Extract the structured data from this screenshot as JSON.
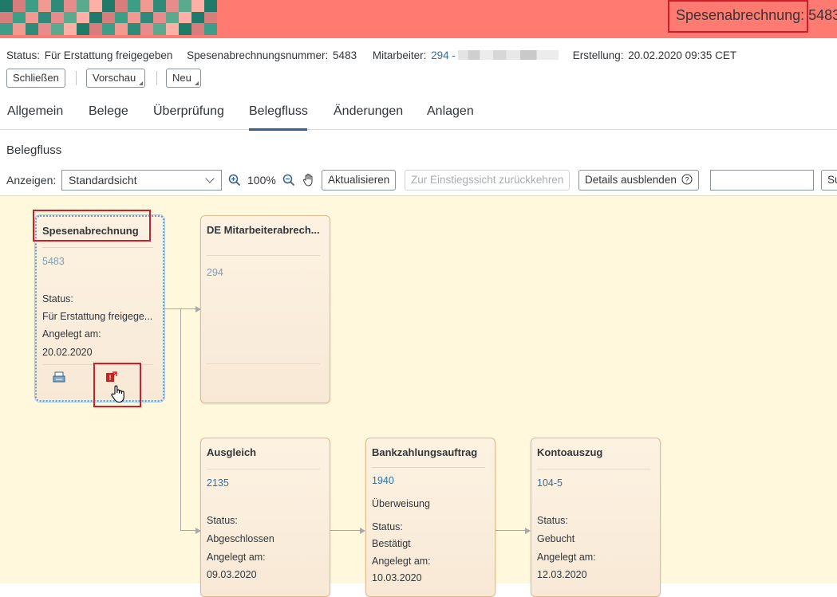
{
  "app": {
    "title": "Spesenabrechnung: 5483",
    "colors": {
      "topbar": "#ff7a70",
      "highlight": "#d11d2a",
      "link": "#2f6fa5",
      "canvas": "#fff8dc"
    }
  },
  "header": {
    "status_label": "Status:",
    "status_value": "Für Erstattung freigegeben",
    "number_label": "Spesenabrechnungsnummer:",
    "number_value": "5483",
    "employee_label": "Mitarbeiter:",
    "employee_value": "294 -",
    "created_label": "Erstellung:",
    "created_value": "20.02.2020 09:35 CET"
  },
  "actions": {
    "close": "Schließen",
    "preview": "Vorschau",
    "new": "Neu"
  },
  "tabs": [
    "Allgemein",
    "Belege",
    "Überprüfung",
    "Belegfluss",
    "Änderungen",
    "Anlagen"
  ],
  "active_tab": "Belegfluss",
  "section": {
    "title": "Belegfluss"
  },
  "toolbar": {
    "show_label": "Anzeigen:",
    "view_value": "Standardsicht",
    "zoom": "100%",
    "refresh": "Aktualisieren",
    "back_to_start": "Zur Einstiegssicht zurückkehren",
    "hide_details": "Details ausblenden",
    "search_button": "Su"
  },
  "nodes": {
    "expense": {
      "title": "Spesenabrechnung",
      "number": "5483",
      "status_label": "Status:",
      "status": "Für Erstattung freigege...",
      "created_label": "Angelegt am:",
      "created": "20.02.2020",
      "icons": [
        "document-print-icon",
        "output-error-icon"
      ]
    },
    "payroll": {
      "title": "DE Mitarbeiterabrech...",
      "number": "294"
    },
    "clearing": {
      "title": "Ausgleich",
      "number": "2135",
      "status_label": "Status:",
      "status": "Abgeschlossen",
      "created_label": "Angelegt am:",
      "created": "09.03.2020"
    },
    "payment": {
      "title": "Bankzahlungsauftrag",
      "number": "1940",
      "type": "Überweisung",
      "status_label": "Status:",
      "status": "Bestätigt",
      "created_label": "Angelegt am:",
      "created": "10.03.2020"
    },
    "statement": {
      "title": "Kontoauszug",
      "number": "104-5",
      "status_label": "Status:",
      "status": "Gebucht",
      "created_label": "Angelegt am:",
      "created": "12.03.2020"
    }
  }
}
